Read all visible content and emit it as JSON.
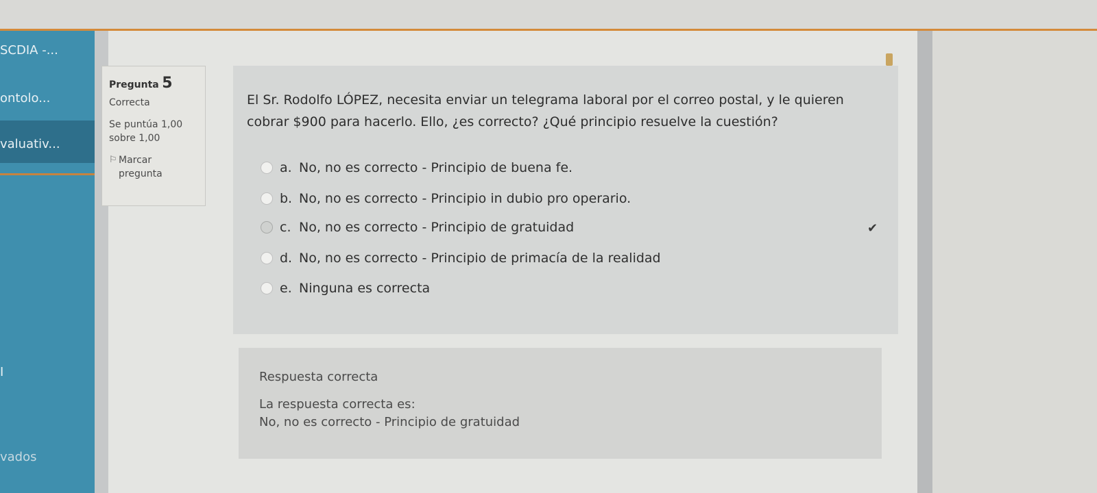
{
  "sidebar": {
    "items": [
      {
        "label": "SCDIA -..."
      },
      {
        "label": "ontolo..."
      },
      {
        "label": "valuativ..."
      },
      {
        "label": "I"
      },
      {
        "label": "vados"
      }
    ]
  },
  "info": {
    "question_label": "Pregunta",
    "question_number": "5",
    "status": "Correcta",
    "score": "Se puntúa 1,00 sobre 1,00",
    "flag_label": "Marcar pregunta"
  },
  "question": {
    "text": "El Sr. Rodolfo LÓPEZ, necesita enviar un telegrama laboral por el correo postal, y le quieren cobrar $900 para hacerlo. Ello, ¿es correcto? ¿Qué principio resuelve la cuestión?",
    "answers": [
      {
        "letter": "a.",
        "text": "No, no es correcto - Principio de buena fe."
      },
      {
        "letter": "b.",
        "text": "No, no es correcto - Principio in dubio pro operario."
      },
      {
        "letter": "c.",
        "text": "No, no es correcto - Principio de gratuidad"
      },
      {
        "letter": "d.",
        "text": "No, no es correcto - Principio de primacía de la realidad"
      },
      {
        "letter": "e.",
        "text": "Ninguna es correcta"
      }
    ],
    "selected": "c."
  },
  "feedback": {
    "status": "Respuesta correcta",
    "intro": "La respuesta correcta es:",
    "answer": "No, no es correcto - Principio de gratuidad"
  },
  "icons": {
    "check": "check-icon",
    "flag": "flag-icon"
  }
}
